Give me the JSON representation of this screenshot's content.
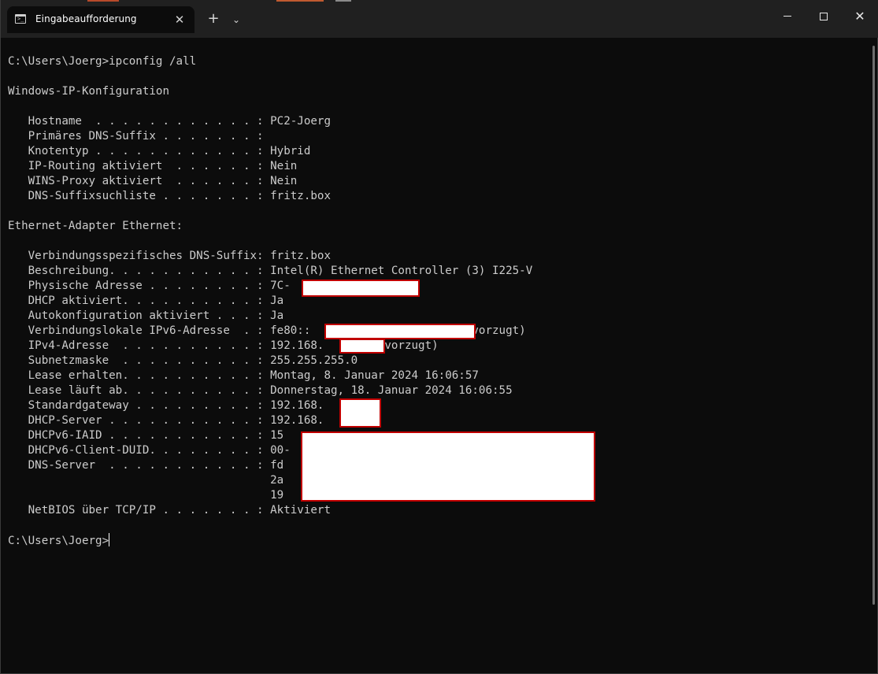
{
  "window": {
    "tab_title": "Eingabeaufforderung",
    "tab_close_glyph": "✕",
    "new_tab_glyph": "+",
    "dropdown_glyph": "⌄",
    "close_glyph": "✕",
    "icons": [
      "console-icon",
      "close-icon",
      "plus-icon",
      "chevron-down-icon",
      "minimize-icon",
      "maximize-icon",
      "close-icon"
    ]
  },
  "terminal": {
    "lines": [
      "",
      "C:\\Users\\Joerg>ipconfig /all",
      "",
      "Windows-IP-Konfiguration",
      "",
      "   Hostname  . . . . . . . . . . . . : PC2-Joerg",
      "   Primäres DNS-Suffix . . . . . . . :",
      "   Knotentyp . . . . . . . . . . . . : Hybrid",
      "   IP-Routing aktiviert  . . . . . . : Nein",
      "   WINS-Proxy aktiviert  . . . . . . : Nein",
      "   DNS-Suffixsuchliste . . . . . . . : fritz.box",
      "",
      "Ethernet-Adapter Ethernet:",
      "",
      "   Verbindungsspezifisches DNS-Suffix: fritz.box",
      "   Beschreibung. . . . . . . . . . . : Intel(R) Ethernet Controller (3) I225-V",
      "   Physische Adresse . . . . . . . . : 7C-",
      "   DHCP aktiviert. . . . . . . . . . : Ja",
      "   Autokonfiguration aktiviert . . . : Ja",
      "   Verbindungslokale IPv6-Adresse  . : fe80::                     (Bevorzugt)",
      "   IPv4-Adresse  . . . . . . . . . . : 192.168.      (Bevorzugt)",
      "   Subnetzmaske  . . . . . . . . . . : 255.255.255.0",
      "   Lease erhalten. . . . . . . . . . : Montag, 8. Januar 2024 16:06:57",
      "   Lease läuft ab. . . . . . . . . . : Donnerstag, 18. Januar 2024 16:06:55",
      "   Standardgateway . . . . . . . . . : 192.168.",
      "   DHCP-Server . . . . . . . . . . . : 192.168.",
      "   DHCPv6-IAID . . . . . . . . . . . : 15",
      "   DHCPv6-Client-DUID. . . . . . . . : 00-",
      "   DNS-Server  . . . . . . . . . . . : fd",
      "                                       2a",
      "                                       19",
      "   NetBIOS über TCP/IP . . . . . . . : Aktiviert",
      ""
    ],
    "prompt": "C:\\Users\\Joerg>"
  }
}
